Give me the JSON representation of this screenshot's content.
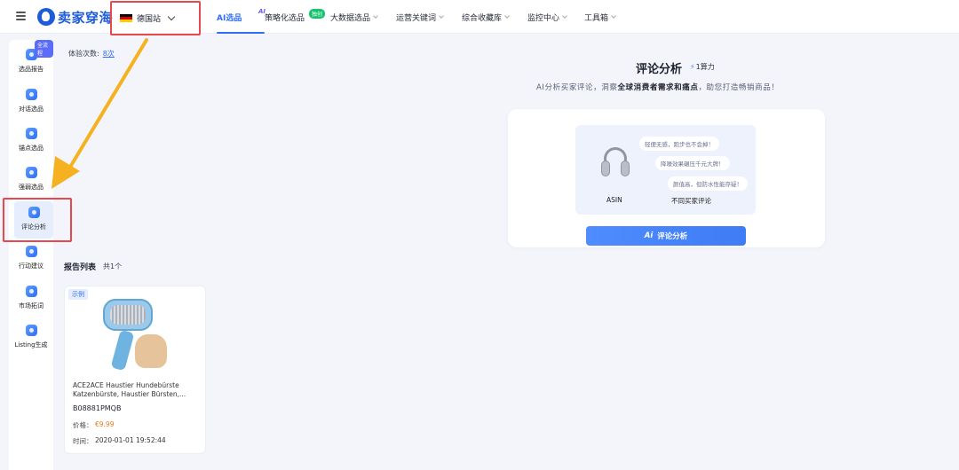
{
  "header": {
    "logo_text": "卖家穿海",
    "site": {
      "label": "德国站",
      "flag_colors": [
        "#000000",
        "#dd0000",
        "#ffce00"
      ]
    },
    "nav": [
      {
        "label": "AI选品",
        "badge": "AI",
        "active": true
      },
      {
        "label": "策略化选品",
        "badge": "独创"
      },
      {
        "label": "大数据选品"
      },
      {
        "label": "运营关键词"
      },
      {
        "label": "综合收藏库"
      },
      {
        "label": "监控中心"
      },
      {
        "label": "工具箱"
      }
    ]
  },
  "sidebar": {
    "badge": "全流程",
    "items": [
      {
        "label": "选品报告"
      },
      {
        "label": "对话选品"
      },
      {
        "label": "锚点选品"
      },
      {
        "label": "强弱选品"
      },
      {
        "label": "评论分析",
        "active": true
      },
      {
        "label": "行动建议"
      },
      {
        "label": "市场拓词"
      },
      {
        "label": "Listing生成"
      }
    ]
  },
  "trial": {
    "label": "体验次数:",
    "value": "8次"
  },
  "hero": {
    "title": "评论分析",
    "power": "1算力",
    "subtitle_pre": "AI分析买家评论，洞察",
    "subtitle_bold": "全球消费者需求和痛点",
    "subtitle_post": "，助您打造畅销商品！",
    "asin_label": "ASIN",
    "buyer_label": "不同买家评论",
    "bubbles": [
      "轻便无感，跑步也不会掉！",
      "降噪效果碾压千元大牌！",
      "颜值高，但防水性能存疑！"
    ],
    "cta_ai": "Ai",
    "cta_label": "评论分析"
  },
  "report_list": {
    "title": "报告列表",
    "count": "共1个",
    "items": [
      {
        "tag": "示例",
        "name": "ACE2ACE Haustier Hundebürste Katzenbürste, Haustier Bürsten,...",
        "asin": "B08881PMQB",
        "price_label": "价格：",
        "price": "€9.99",
        "time_label": "时间：",
        "time": "2020-01-01 19:52:44"
      }
    ]
  },
  "colors": {
    "accent": "#2f6ff5",
    "highlight": "#e5484d",
    "arrow": "#f5b120",
    "price": "#f07a1a"
  }
}
